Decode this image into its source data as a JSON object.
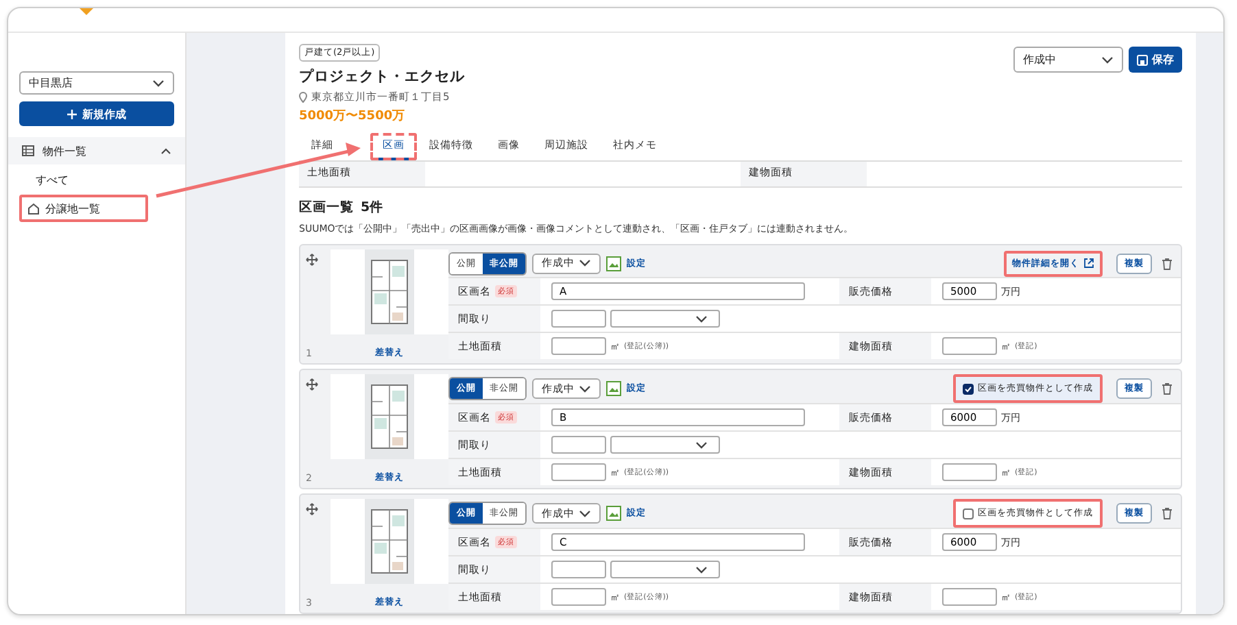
{
  "sidebar": {
    "store_select": "中目黒店",
    "new_button": "新規作成",
    "nav": {
      "label": "物件一覧",
      "expanded": true,
      "children": [
        {
          "label": "すべて",
          "kind": "plain",
          "highlighted": false
        },
        {
          "label": "分譲地一覧",
          "kind": "house",
          "highlighted": true
        }
      ]
    }
  },
  "project": {
    "type_badge": "戸建て(2戸以上)",
    "title": "プロジェクト・エクセル",
    "address": "東京都立川市一番町１丁目5",
    "price": "5000万〜5500万"
  },
  "status_select": "作成中",
  "save_button": "保存",
  "tabs": [
    {
      "label": "詳細",
      "selected": false,
      "highlighted": false
    },
    {
      "label": "区画",
      "selected": true,
      "highlighted": true
    },
    {
      "label": "設備特徴",
      "selected": false,
      "highlighted": false
    },
    {
      "label": "画像",
      "selected": false,
      "highlighted": false
    },
    {
      "label": "周辺施設",
      "selected": false,
      "highlighted": false
    },
    {
      "label": "社内メモ",
      "selected": false,
      "highlighted": false
    }
  ],
  "area_info": [
    {
      "label": "土地面積"
    },
    {
      "label": "建物面積"
    }
  ],
  "section": {
    "title": "区画一覧",
    "count": "5件",
    "note": "SUUMOでは「公開中」「売出中」の区画画像が画像・画像コメントとして連動され、「区画・住戸タブ」には連動されません。"
  },
  "lots": [
    {
      "number": "1",
      "replace_link": "差替え",
      "visibility": [
        {
          "label": "公開",
          "selected": false
        },
        {
          "label": "非公開",
          "selected": true
        }
      ],
      "status": "作成中",
      "settings_link": "設定",
      "action": {
        "kind": "link",
        "label": "物件詳細を開く",
        "highlighted": true
      },
      "copy_button": "複製",
      "name_label": "区画名",
      "required": "必須",
      "name_value": "A",
      "price_label": "販売価格",
      "price_value": "5000",
      "price_unit": "万円",
      "layout_label": "間取り",
      "land_label": "土地面積",
      "land_unit": "㎡",
      "land_note": "(登記(公簿))",
      "building_label": "建物面積",
      "building_unit": "㎡",
      "building_note": "(登記)"
    },
    {
      "number": "2",
      "replace_link": "差替え",
      "visibility": [
        {
          "label": "公開",
          "selected": true
        },
        {
          "label": "非公開",
          "selected": false
        }
      ],
      "status": "作成中",
      "settings_link": "設定",
      "action": {
        "kind": "checkbox",
        "label": "区画を売買物件として作成",
        "checked": true,
        "highlighted": true
      },
      "copy_button": "複製",
      "name_label": "区画名",
      "required": "必須",
      "name_value": "B",
      "price_label": "販売価格",
      "price_value": "6000",
      "price_unit": "万円",
      "layout_label": "間取り",
      "land_label": "土地面積",
      "land_unit": "㎡",
      "land_note": "(登記(公簿))",
      "building_label": "建物面積",
      "building_unit": "㎡",
      "building_note": "(登記)"
    },
    {
      "number": "3",
      "replace_link": "差替え",
      "visibility": [
        {
          "label": "公開",
          "selected": true
        },
        {
          "label": "非公開",
          "selected": false
        }
      ],
      "status": "作成中",
      "settings_link": "設定",
      "action": {
        "kind": "checkbox",
        "label": "区画を売買物件として作成",
        "checked": false,
        "highlighted": true
      },
      "copy_button": "複製",
      "name_label": "区画名",
      "required": "必須",
      "name_value": "C",
      "price_label": "販売価格",
      "price_value": "6000",
      "price_unit": "万円",
      "layout_label": "間取り",
      "land_label": "土地面積",
      "land_unit": "㎡",
      "land_note": "(登記(公簿))",
      "building_label": "建物面積",
      "building_unit": "㎡",
      "building_note": "(登記)"
    }
  ]
}
